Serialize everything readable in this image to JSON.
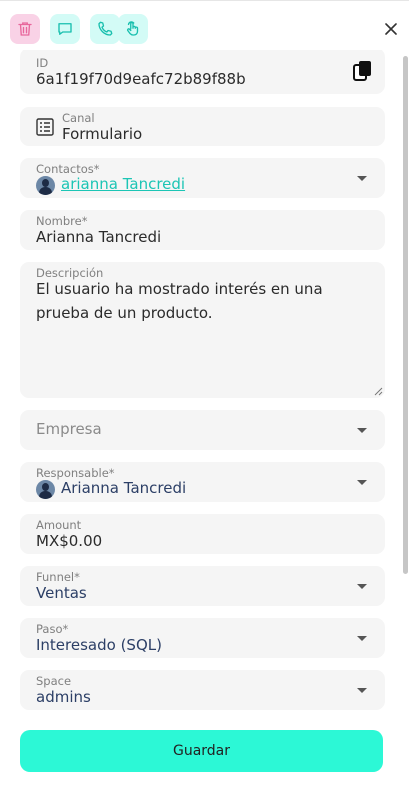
{
  "toolbar": {
    "buttons": [
      {
        "icon": "trash-icon",
        "color": "#f9d2e6"
      },
      {
        "icon": "chat-icon",
        "color": "#d3fbf6"
      },
      {
        "icon": "phone-icon",
        "color": "#d3fbf6"
      },
      {
        "icon": "hand-pointer-icon",
        "color": "#d3fbf6"
      }
    ],
    "close_icon": "close-icon"
  },
  "form": {
    "id": {
      "label": "ID",
      "value": "6a1f19f70d9eafc72b89f88b",
      "icon": "copy-icon"
    },
    "canal": {
      "label": "Canal",
      "value": "Formulario",
      "icon": "form-list-icon"
    },
    "contactos": {
      "label": "Contactos*",
      "value": "arianna Tancredi"
    },
    "nombre": {
      "label": "Nombre*",
      "value": "Arianna Tancredi"
    },
    "descripcion": {
      "label": "Descripción",
      "line1": "El usuario ha mostrado interés en una",
      "line2": "prueba de un producto."
    },
    "empresa": {
      "placeholder": "Empresa"
    },
    "responsable": {
      "label": "Responsable*",
      "value": "Arianna Tancredi"
    },
    "amount": {
      "label": "Amount",
      "value": "MX$0.00"
    },
    "funnel": {
      "label": "Funnel*",
      "value": "Ventas"
    },
    "paso": {
      "label": "Paso*",
      "value": "Interesado (SQL)"
    },
    "space": {
      "label": "Space",
      "value": "admins"
    }
  },
  "save_label": "Guardar",
  "colors": {
    "accent": "#2cf8d6",
    "link": "#1cc5b5",
    "delete": "#f9d2e6",
    "field_bg": "#f5f5f5"
  }
}
